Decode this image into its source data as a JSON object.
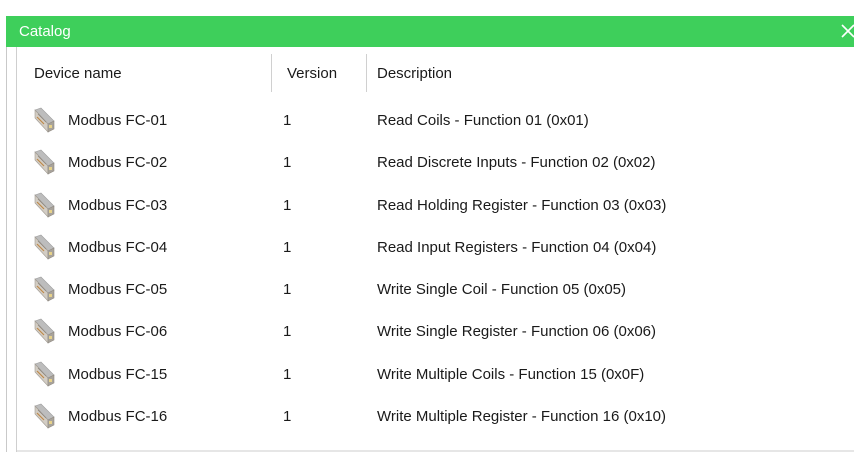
{
  "window": {
    "title": "Catalog",
    "close_icon": "close-icon",
    "accent_color": "#3ecf5b"
  },
  "table": {
    "headers": {
      "name": "Device name",
      "version": "Version",
      "description": "Description"
    },
    "row_icon": "device-module-icon",
    "rows": [
      {
        "name": "Modbus FC-01",
        "version": "1",
        "description": "Read Coils - Function 01 (0x01)"
      },
      {
        "name": "Modbus FC-02",
        "version": "1",
        "description": "Read Discrete Inputs - Function 02 (0x02)"
      },
      {
        "name": "Modbus FC-03",
        "version": "1",
        "description": "Read Holding Register - Function 03 (0x03)"
      },
      {
        "name": "Modbus FC-04",
        "version": "1",
        "description": "Read Input Registers - Function 04 (0x04)"
      },
      {
        "name": "Modbus FC-05",
        "version": "1",
        "description": "Write Single Coil - Function 05 (0x05)"
      },
      {
        "name": "Modbus FC-06",
        "version": "1",
        "description": "Write Single Register - Function 06 (0x06)"
      },
      {
        "name": "Modbus FC-15",
        "version": "1",
        "description": "Write Multiple Coils - Function 15 (0x0F)"
      },
      {
        "name": "Modbus FC-16",
        "version": "1",
        "description": "Write Multiple Register - Function 16 (0x10)"
      }
    ]
  }
}
